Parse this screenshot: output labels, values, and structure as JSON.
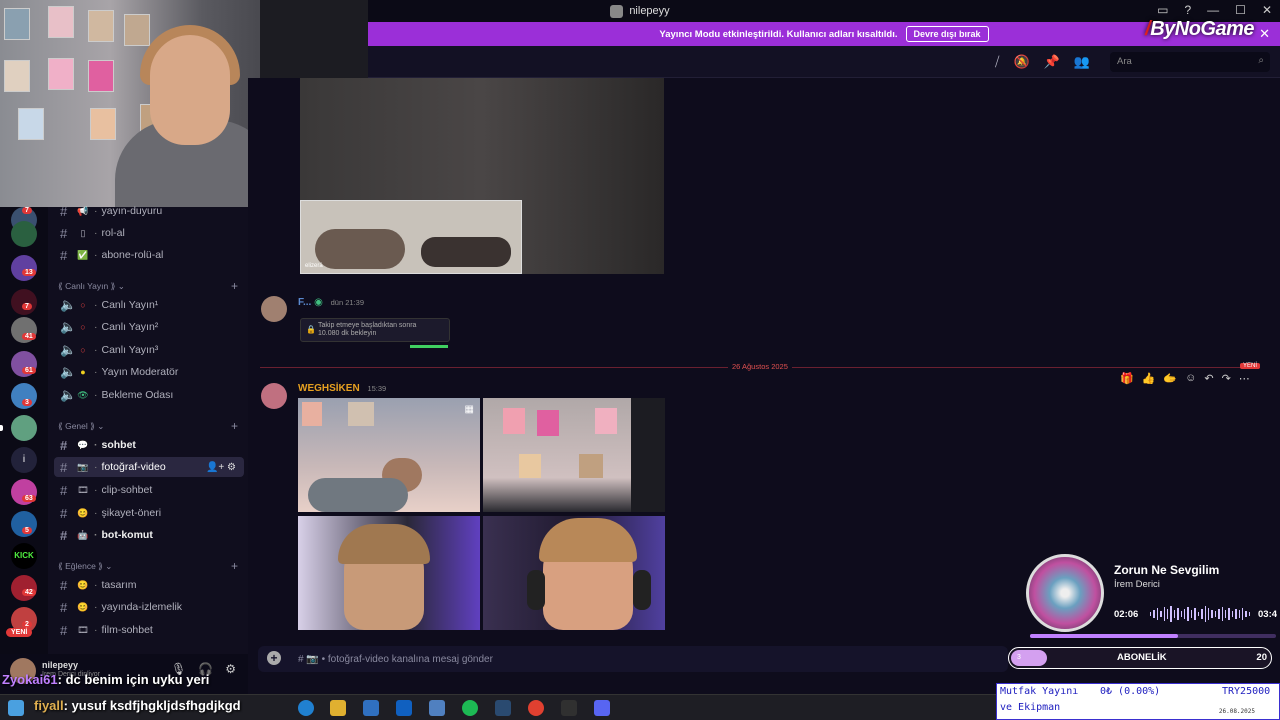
{
  "window": {
    "title": "nilepeyy",
    "controls": [
      "▭",
      "?",
      "—",
      "☐",
      "✕"
    ]
  },
  "banner": {
    "text": "Yayıncı Modu etkinleştirildi. Kullanıcı adları kısaltıldı.",
    "button": "Devre dışı bırak",
    "close": "✕",
    "logo_slash": "/",
    "logo_text": "ByNoGame"
  },
  "header": {
    "icons": [
      "threads-icon",
      "mute-icon",
      "pin-icon",
      "members-icon"
    ],
    "search_placeholder": "Ara"
  },
  "servers": {
    "badges": [
      "7",
      "13",
      "7",
      "41",
      "61",
      "3",
      "63",
      "5",
      "42",
      "2"
    ],
    "yeni": "YENİ",
    "kick": "KICK",
    "info": "i"
  },
  "channels": {
    "top": [
      {
        "emoji": "📢",
        "name": "yayın-duyuru"
      },
      {
        "emoji": "▯",
        "name": "rol-al"
      },
      {
        "emoji": "✅",
        "name": "abone-rolü-al"
      }
    ],
    "cat_live": "⟪ Canlı Yayın ⟫",
    "live": [
      {
        "name": "Canlı Yayın¹"
      },
      {
        "name": "Canlı Yayın²"
      },
      {
        "name": "Canlı Yayın³"
      },
      {
        "name": "Yayın Moderatör"
      },
      {
        "name": "Bekleme Odası"
      }
    ],
    "cat_general": "⟪ Genel ⟫",
    "general": [
      {
        "emoji": "💬",
        "name": "sohbet"
      },
      {
        "emoji": "📷",
        "name": "fotoğraf-video"
      },
      {
        "emoji": "🎞",
        "name": "clip-sohbet"
      },
      {
        "emoji": "😊",
        "name": "şikayet-öneri"
      },
      {
        "emoji": "🤖",
        "name": "bot-komut"
      }
    ],
    "cat_fun": "⟪ Eğlence ⟫",
    "fun": [
      {
        "emoji": "😊",
        "name": "tasarım"
      },
      {
        "emoji": "😊",
        "name": "yayında-izlemelik"
      },
      {
        "emoji": "🎞",
        "name": "film-sohbet"
      }
    ]
  },
  "user_panel": {
    "name": "nilepeyy",
    "status": "İrem Derici dinliyor"
  },
  "overlay_chat": {
    "user": "Zyokai61",
    "message": ": dc benim için uyku yeri"
  },
  "messages": {
    "msg1_author": "F...",
    "msg1_time": "dün 21:39",
    "lock_text_1": "Takip etmeye başladıktan sonra",
    "lock_text_2": "10.080 dk bekleyin",
    "attach_label": "elizerä",
    "divider_date": "26 Ağustos 2025",
    "divider_new": "YENİ",
    "msg2_author": "WEGHSİKEN",
    "msg2_time": "15:39",
    "author_color": "#e6a020"
  },
  "hover_bar": [
    "🎁",
    "👍",
    "🫱",
    "☺",
    "↶",
    "↷",
    "⋯"
  ],
  "composer": {
    "placeholder": "# 📷 • fotoğraf-video kanalına mesaj gönder"
  },
  "music": {
    "song": "Zorun Ne Sevgilim",
    "artist": "İrem Derici",
    "current": "02:06",
    "end": "03:4",
    "progress": 0.6
  },
  "subscription": {
    "pill": "3",
    "label": "ABONELİK",
    "count": "20"
  },
  "taskbar_overlay": {
    "user": "fiyall",
    "message": ": yusuf ksdfjhgkljdsfhgdjkgd"
  },
  "ticker": {
    "line1": "Mutfak Yayını",
    "pct": "0₺ (0.00%)",
    "price": "TRY25000",
    "line2": "ve Ekipman",
    "date": "26.08.2025"
  }
}
